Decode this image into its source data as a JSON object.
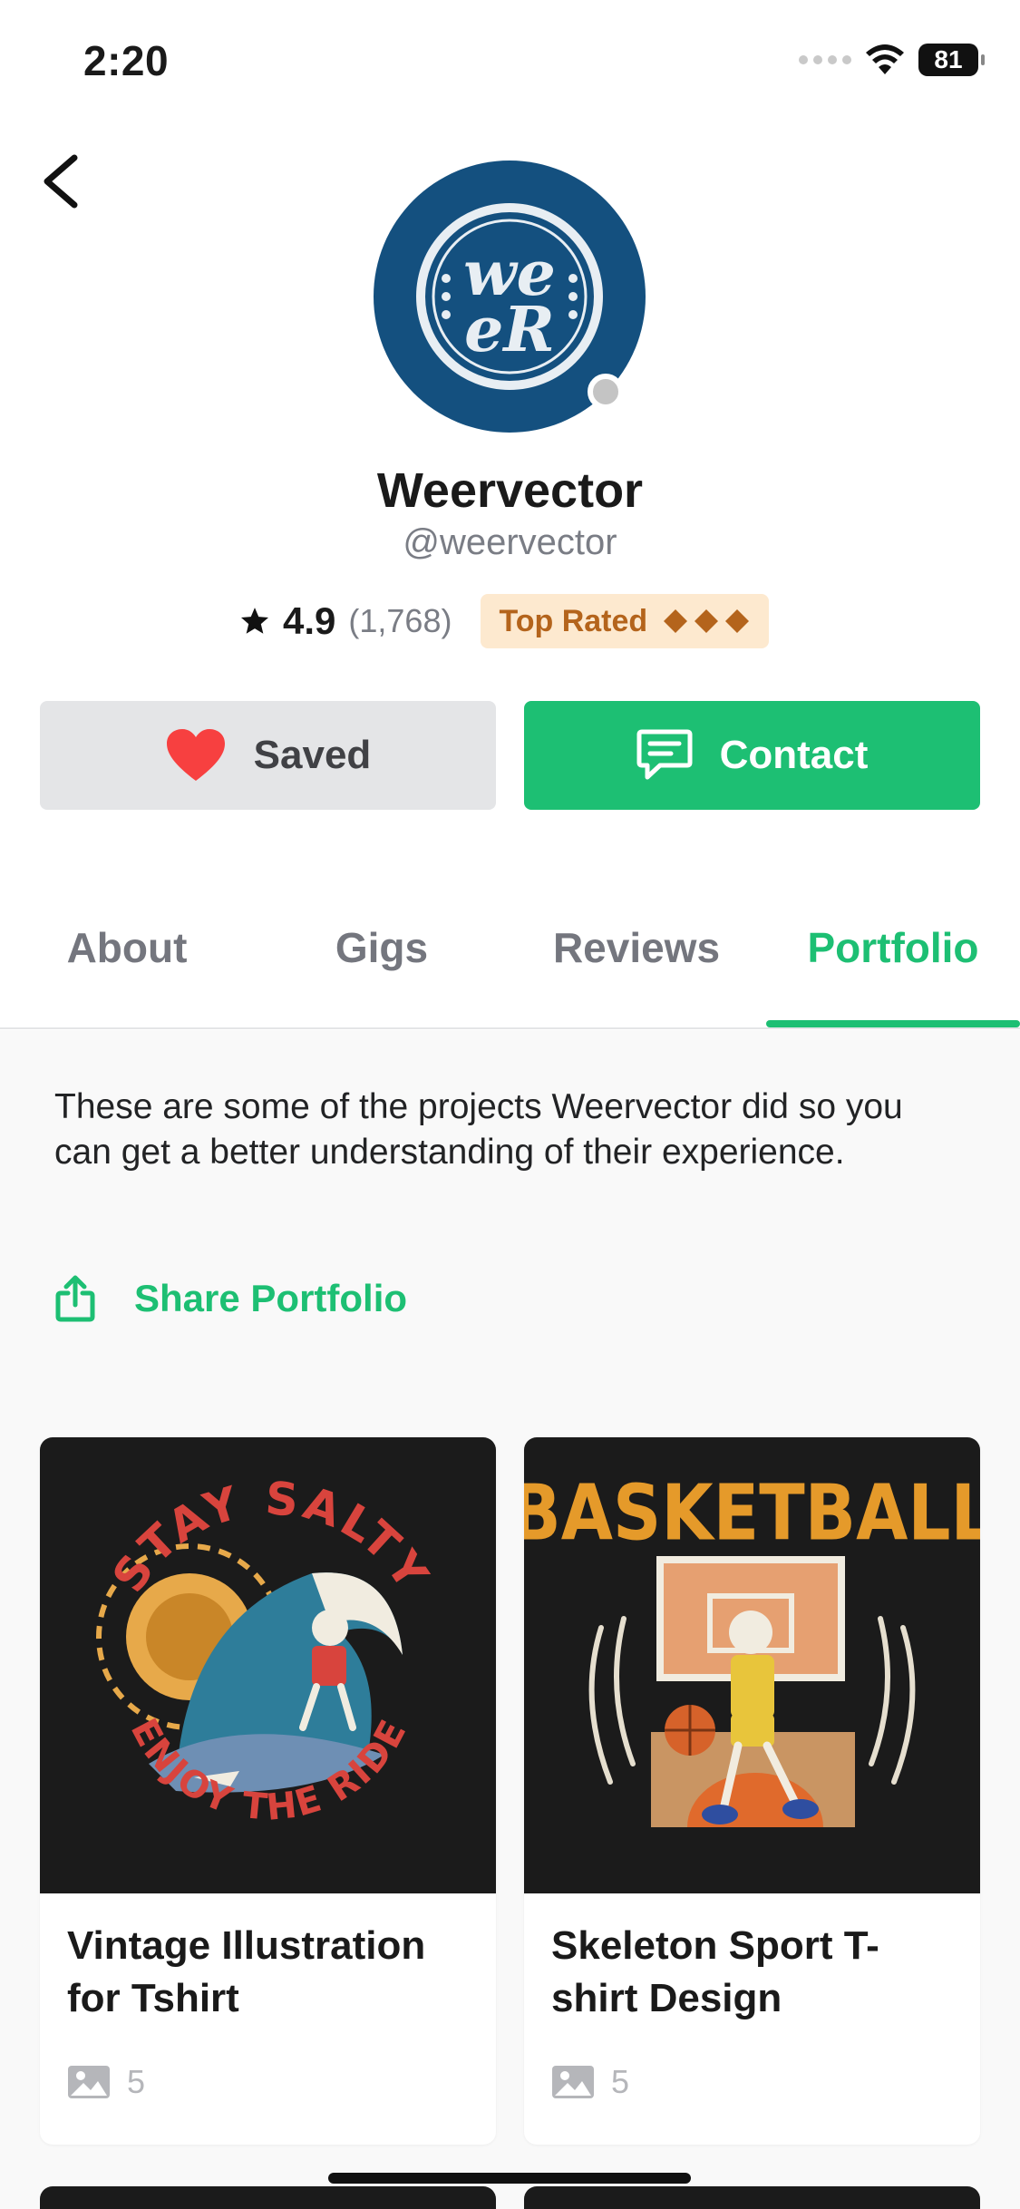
{
  "status_bar": {
    "time": "2:20",
    "battery": "81"
  },
  "profile": {
    "name": "Weervector",
    "handle": "@weervector",
    "avatar_logo": "WEER",
    "rating": "4.9",
    "rating_count": "(1,768)",
    "badge": "Top Rated",
    "badge_icon": "diamond-icon"
  },
  "actions": {
    "saved_label": "Saved",
    "contact_label": "Contact"
  },
  "tabs": [
    {
      "label": "About"
    },
    {
      "label": "Gigs"
    },
    {
      "label": "Reviews"
    },
    {
      "label": "Portfolio"
    }
  ],
  "portfolio": {
    "description": "These are some of the projects Weervector did so you can get a better understanding of their experience.",
    "share_label": "Share Portfolio",
    "items": [
      {
        "title": "Vintage Illustration for Tshirt",
        "image_count": "5",
        "art_top_text": "STAY SALTY",
        "art_bottom_text": "ENJOY THE RIDE"
      },
      {
        "title": "Skeleton Sport T-shirt Design",
        "image_count": "5",
        "art_top_text": "BASKETBALL"
      }
    ]
  },
  "colors": {
    "brand_green": "#1dbf73",
    "avatar_blue": "#14507f",
    "heart_red": "#f74040",
    "badge_bg": "#fde9cf",
    "badge_text": "#b4641c"
  }
}
